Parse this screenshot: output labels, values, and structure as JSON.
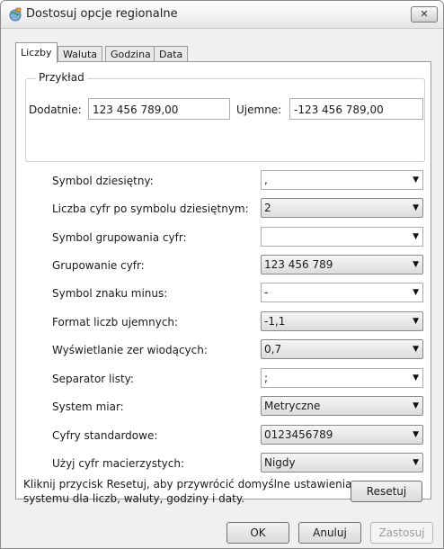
{
  "window": {
    "title": "Dostosuj opcje regionalne",
    "close_label": "✕"
  },
  "tabs": [
    {
      "label": "Liczby",
      "active": true
    },
    {
      "label": "Waluta",
      "active": false
    },
    {
      "label": "Godzina",
      "active": false
    },
    {
      "label": "Data",
      "active": false
    }
  ],
  "example": {
    "group_label": "Przykład",
    "positive_label": "Dodatnie:",
    "positive_value": "123 456 789,00",
    "negative_label": "Ujemne:",
    "negative_value": "-123 456 789,00"
  },
  "settings": [
    {
      "label": "Symbol dziesiętny:",
      "value": ",",
      "style": "edit"
    },
    {
      "label": "Liczba cyfr po symbolu dziesiętnym:",
      "value": "2",
      "style": "list"
    },
    {
      "label": "Symbol grupowania cyfr:",
      "value": "",
      "style": "edit"
    },
    {
      "label": "Grupowanie cyfr:",
      "value": "123 456 789",
      "style": "list"
    },
    {
      "label": "Symbol znaku minus:",
      "value": "-",
      "style": "edit"
    },
    {
      "label": "Format liczb ujemnych:",
      "value": "-1,1",
      "style": "list"
    },
    {
      "label": "Wyświetlanie zer wiodących:",
      "value": "0,7",
      "style": "list"
    },
    {
      "label": "Separator listy:",
      "value": ";",
      "style": "edit"
    },
    {
      "label": "System miar:",
      "value": "Metryczne",
      "style": "list"
    },
    {
      "label": "Cyfry standardowe:",
      "value": "0123456789",
      "style": "list"
    },
    {
      "label": "Użyj cyfr macierzystych:",
      "value": "Nigdy",
      "style": "list"
    }
  ],
  "reset": {
    "hint": "Kliknij przycisk Resetuj, aby przywrócić domyślne ustawienia systemu dla liczb, waluty, godziny i daty.",
    "button": "Resetuj"
  },
  "buttons": {
    "ok": "OK",
    "cancel": "Anuluj",
    "apply": "Zastosuj"
  }
}
